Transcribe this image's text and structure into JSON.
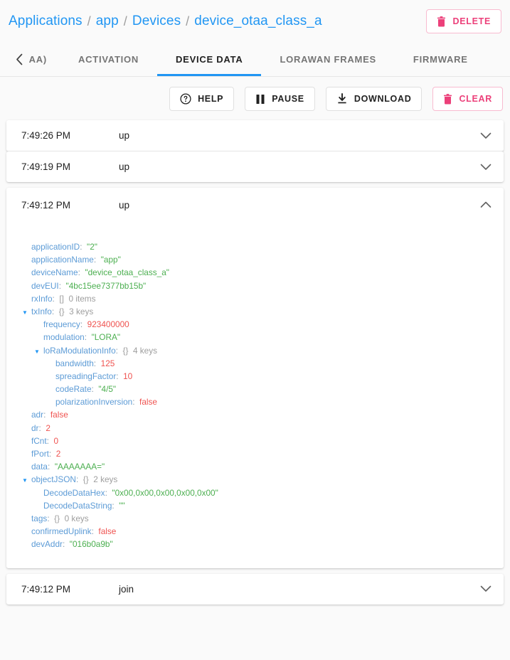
{
  "header": {
    "breadcrumb": [
      {
        "label": "Applications",
        "link": true
      },
      {
        "label": "app",
        "link": true
      },
      {
        "label": "Devices",
        "link": true
      },
      {
        "label": "device_otaa_class_a",
        "link": true
      }
    ],
    "separator": "/",
    "delete_button": {
      "label": "DELETE",
      "icon": "trash-icon",
      "color": "#ec407a"
    }
  },
  "tabs": {
    "back_arrow_icon": "chevron-left-icon",
    "items": [
      {
        "label": "AA)",
        "active": false,
        "clipped": true
      },
      {
        "label": "ACTIVATION",
        "active": false,
        "clipped": false
      },
      {
        "label": "DEVICE DATA",
        "active": true,
        "clipped": false
      },
      {
        "label": "LORAWAN FRAMES",
        "active": false,
        "clipped": false
      },
      {
        "label": "FIRMWARE",
        "active": false,
        "clipped": false
      }
    ],
    "active_underline_color": "#2196f3"
  },
  "toolbar": {
    "buttons": [
      {
        "label": "HELP",
        "icon": "help-circle-icon",
        "danger": false
      },
      {
        "label": "PAUSE",
        "icon": "pause-icon",
        "danger": false
      },
      {
        "label": "DOWNLOAD",
        "icon": "download-icon",
        "danger": false
      },
      {
        "label": "CLEAR",
        "icon": "trash-icon",
        "danger": true
      }
    ]
  },
  "events": [
    {
      "time": "7:49:26 PM",
      "type": "up",
      "expanded": false
    },
    {
      "time": "7:49:19 PM",
      "type": "up",
      "expanded": false
    },
    {
      "time": "7:49:12 PM",
      "type": "up",
      "expanded": true
    },
    {
      "time": "7:49:12 PM",
      "type": "join",
      "expanded": false
    }
  ],
  "json_tree": [
    {
      "indent": 1,
      "tri": "",
      "key": "applicationID",
      "value": "\"2\"",
      "vclass": "jstr"
    },
    {
      "indent": 1,
      "tri": "",
      "key": "applicationName",
      "value": "\"app\"",
      "vclass": "jstr"
    },
    {
      "indent": 1,
      "tri": "",
      "key": "deviceName",
      "value": "\"device_otaa_class_a\"",
      "vclass": "jstr"
    },
    {
      "indent": 1,
      "tri": "",
      "key": "devEUI",
      "value": "\"4bc15ee7377bb15b\"",
      "vclass": "jstr"
    },
    {
      "indent": 1,
      "tri": "",
      "key": "rxInfo",
      "brace": "[]",
      "meta": "0 items"
    },
    {
      "indent": 1,
      "tri": "▼",
      "key": "txInfo",
      "brace": "{}",
      "meta": "3 keys"
    },
    {
      "indent": 2,
      "tri": "",
      "key": "frequency",
      "value": "923400000",
      "vclass": "jnum"
    },
    {
      "indent": 2,
      "tri": "",
      "key": "modulation",
      "value": "\"LORA\"",
      "vclass": "jstr"
    },
    {
      "indent": 2,
      "tri": "▼",
      "key": "loRaModulationInfo",
      "brace": "{}",
      "meta": "4 keys"
    },
    {
      "indent": 3,
      "tri": "",
      "key": "bandwidth",
      "value": "125",
      "vclass": "jnum"
    },
    {
      "indent": 3,
      "tri": "",
      "key": "spreadingFactor",
      "value": "10",
      "vclass": "jnum"
    },
    {
      "indent": 3,
      "tri": "",
      "key": "codeRate",
      "value": "\"4/5\"",
      "vclass": "jstr"
    },
    {
      "indent": 3,
      "tri": "",
      "key": "polarizationInversion",
      "value": "false",
      "vclass": "jbool"
    },
    {
      "indent": 1,
      "tri": "",
      "key": "adr",
      "value": "false",
      "vclass": "jbool"
    },
    {
      "indent": 1,
      "tri": "",
      "key": "dr",
      "value": "2",
      "vclass": "jnum"
    },
    {
      "indent": 1,
      "tri": "",
      "key": "fCnt",
      "value": "0",
      "vclass": "jnum"
    },
    {
      "indent": 1,
      "tri": "",
      "key": "fPort",
      "value": "2",
      "vclass": "jnum"
    },
    {
      "indent": 1,
      "tri": "",
      "key": "data",
      "value": "\"AAAAAAA=\"",
      "vclass": "jstr"
    },
    {
      "indent": 1,
      "tri": "▼",
      "key": "objectJSON",
      "brace": "{}",
      "meta": "2 keys"
    },
    {
      "indent": 2,
      "tri": "",
      "key": "DecodeDataHex",
      "value": "\"0x00,0x00,0x00,0x00,0x00\"",
      "vclass": "jstr"
    },
    {
      "indent": 2,
      "tri": "",
      "key": "DecodeDataString",
      "value": "\"\"",
      "vclass": "jstr"
    },
    {
      "indent": 1,
      "tri": "",
      "key": "tags",
      "brace": "{}",
      "meta": "0 keys"
    },
    {
      "indent": 1,
      "tri": "",
      "key": "confirmedUplink",
      "value": "false",
      "vclass": "jbool"
    },
    {
      "indent": 1,
      "tri": "",
      "key": "devAddr",
      "value": "\"016b0a9b\"",
      "vclass": "jstr"
    }
  ]
}
